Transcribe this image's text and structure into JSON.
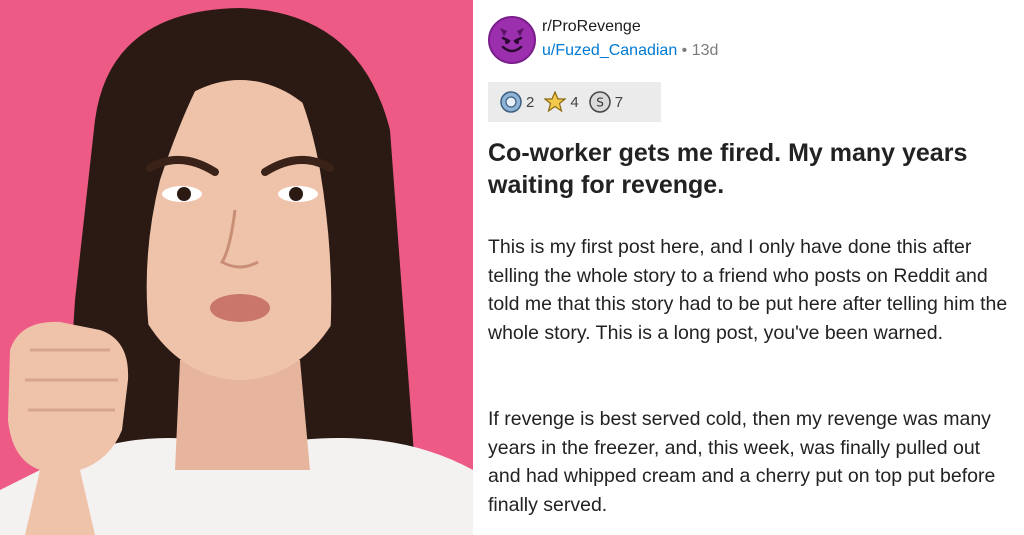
{
  "post": {
    "subreddit": "r/ProRevenge",
    "username": "u/Fuzed_Canadian",
    "separator": "•",
    "age": "13d",
    "awards": [
      {
        "icon": "silver-award-icon",
        "count": "2"
      },
      {
        "icon": "gold-award-icon",
        "count": "4"
      },
      {
        "icon": "platinum-award-icon",
        "count": "7"
      }
    ],
    "title": "Co-worker gets me fired. My many years waiting for revenge.",
    "paragraphs": [
      "This is my first post here, and I only have done this after telling the whole story to a friend who posts on Reddit and told me that this story had to be put here after telling him the whole story. This is a long post, you've been warned.",
      "If revenge is best served cold, then my revenge was many years in the freezer, and, this week, was finally pulled out and had whipped cream and a cherry put on top put before finally served."
    ]
  },
  "colors": {
    "photo_background": "#ee5a86",
    "link_blue": "#0079d3",
    "award_bar": "#ebebeb",
    "avatar_purple": "#9b2fae"
  }
}
